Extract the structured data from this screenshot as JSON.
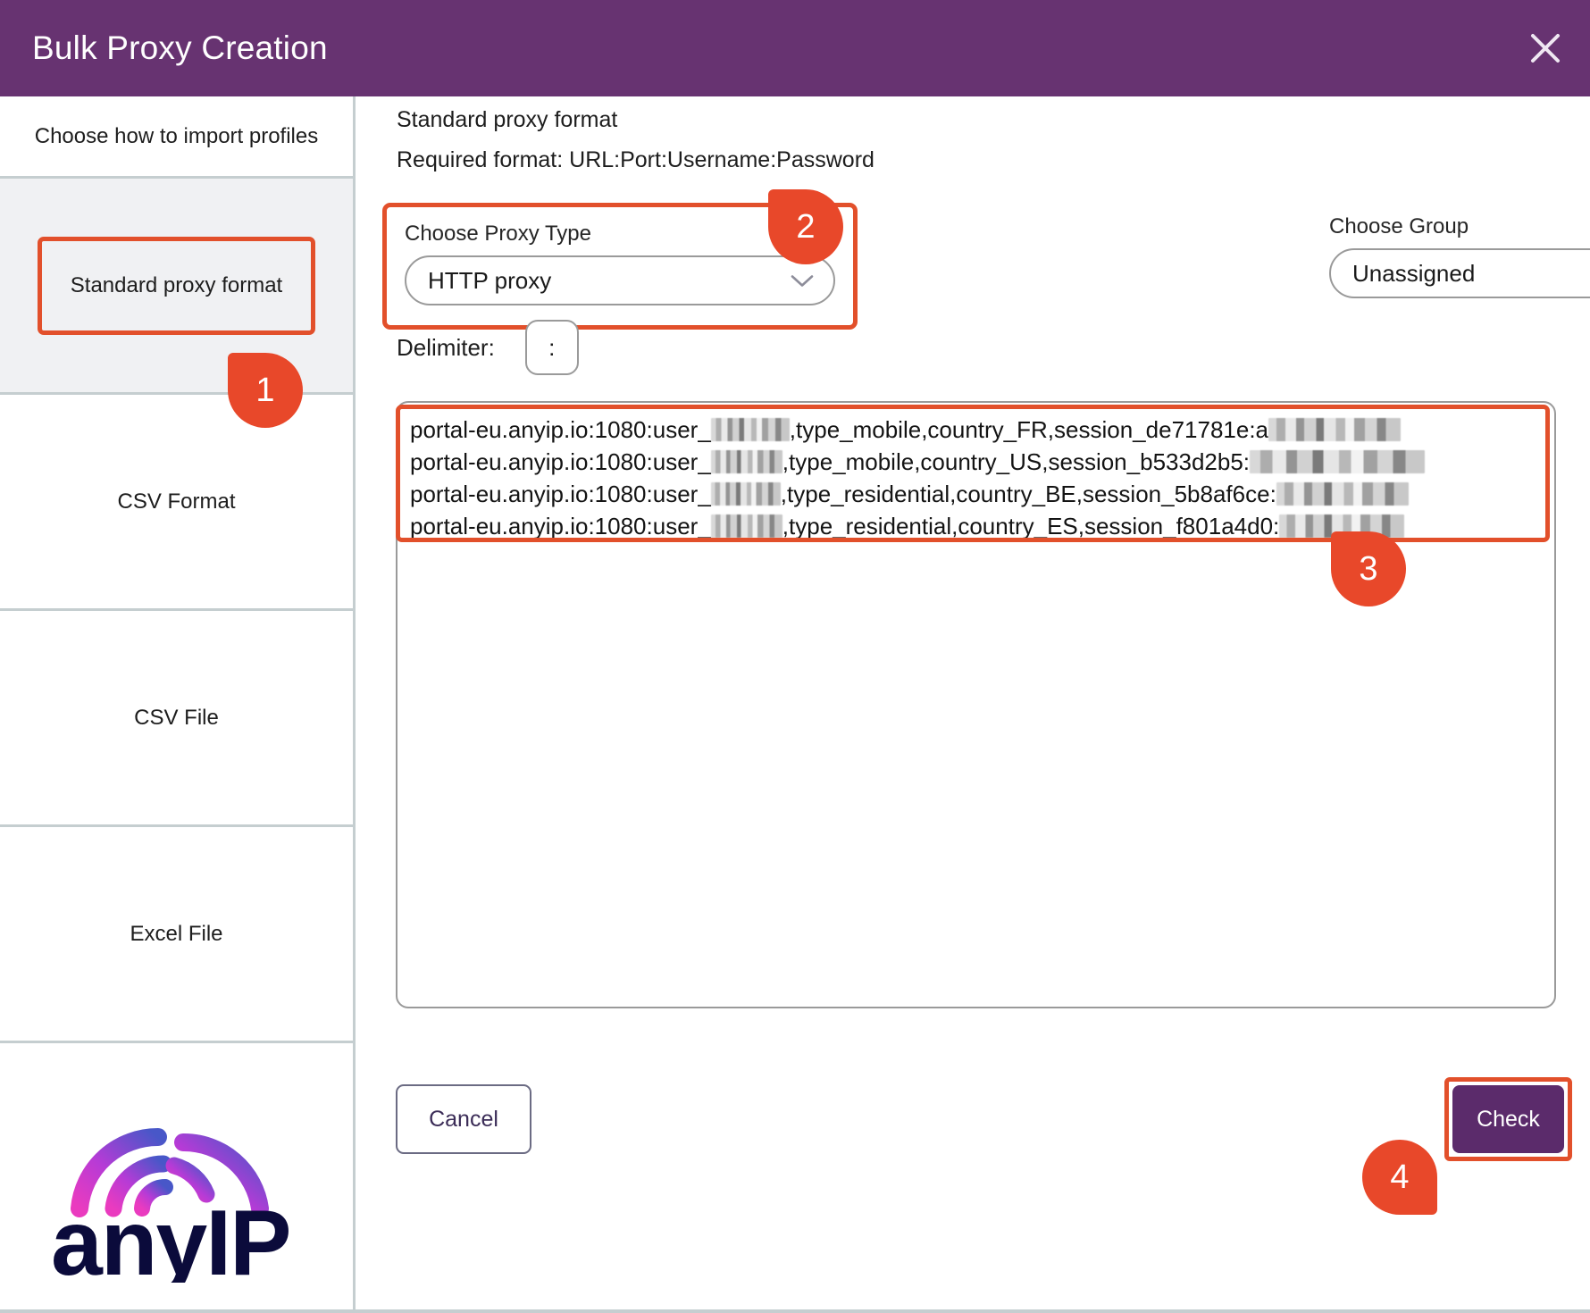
{
  "window": {
    "title": "Bulk Proxy Creation",
    "close_icon": "close-icon",
    "header_color": "#673371",
    "accent_color": "#e2502b"
  },
  "sidebar": {
    "heading": "Choose how to import profiles",
    "items": [
      {
        "label": "Standard proxy format",
        "selected": true,
        "highlighted": true
      },
      {
        "label": "CSV Format",
        "selected": false,
        "highlighted": false
      },
      {
        "label": "CSV File",
        "selected": false,
        "highlighted": false
      },
      {
        "label": "Excel File",
        "selected": false,
        "highlighted": false
      }
    ],
    "logo": {
      "name": "anyip-logo",
      "text": "anyIP"
    }
  },
  "main": {
    "format_title": "Standard proxy format",
    "required_format": "Required format: URL:Port:Username:Password",
    "proxy_type": {
      "label": "Choose Proxy Type",
      "value": "HTTP proxy",
      "caret_icon": "chevron-down-icon"
    },
    "group": {
      "label": "Choose Group",
      "value": "Unassigned",
      "caret_icon": "chevron-down-icon"
    },
    "delimiter": {
      "label": "Delimiter:",
      "value": ":"
    },
    "proxy_list": {
      "lines": [
        {
          "prefix": "portal-eu.anyip.io:1080:user_",
          "redacted_user_width": 88,
          "middle": ",type_mobile,country_FR,session_de71781e:a",
          "redacted_pass_width": 148
        },
        {
          "prefix": "portal-eu.anyip.io:1080:user_",
          "redacted_user_width": 80,
          "middle": ",type_mobile,country_US,session_b533d2b5:",
          "redacted_pass_width": 196
        },
        {
          "prefix": "portal-eu.anyip.io:1080:user_",
          "redacted_user_width": 78,
          "middle": ",type_residential,country_BE,session_5b8af6ce:",
          "redacted_pass_width": 148
        },
        {
          "prefix": "portal-eu.anyip.io:1080:user_",
          "redacted_user_width": 80,
          "middle": ",type_residential,country_ES,session_f801a4d0:",
          "redacted_pass_width": 140
        }
      ]
    },
    "cancel_label": "Cancel",
    "check_label": "Check"
  },
  "annotations": {
    "badges": [
      {
        "number": "1",
        "target": "sidebar-item-standard-proxy-format"
      },
      {
        "number": "2",
        "target": "choose-proxy-type-select"
      },
      {
        "number": "3",
        "target": "proxy-list-textarea"
      },
      {
        "number": "4",
        "target": "check-button"
      }
    ]
  }
}
